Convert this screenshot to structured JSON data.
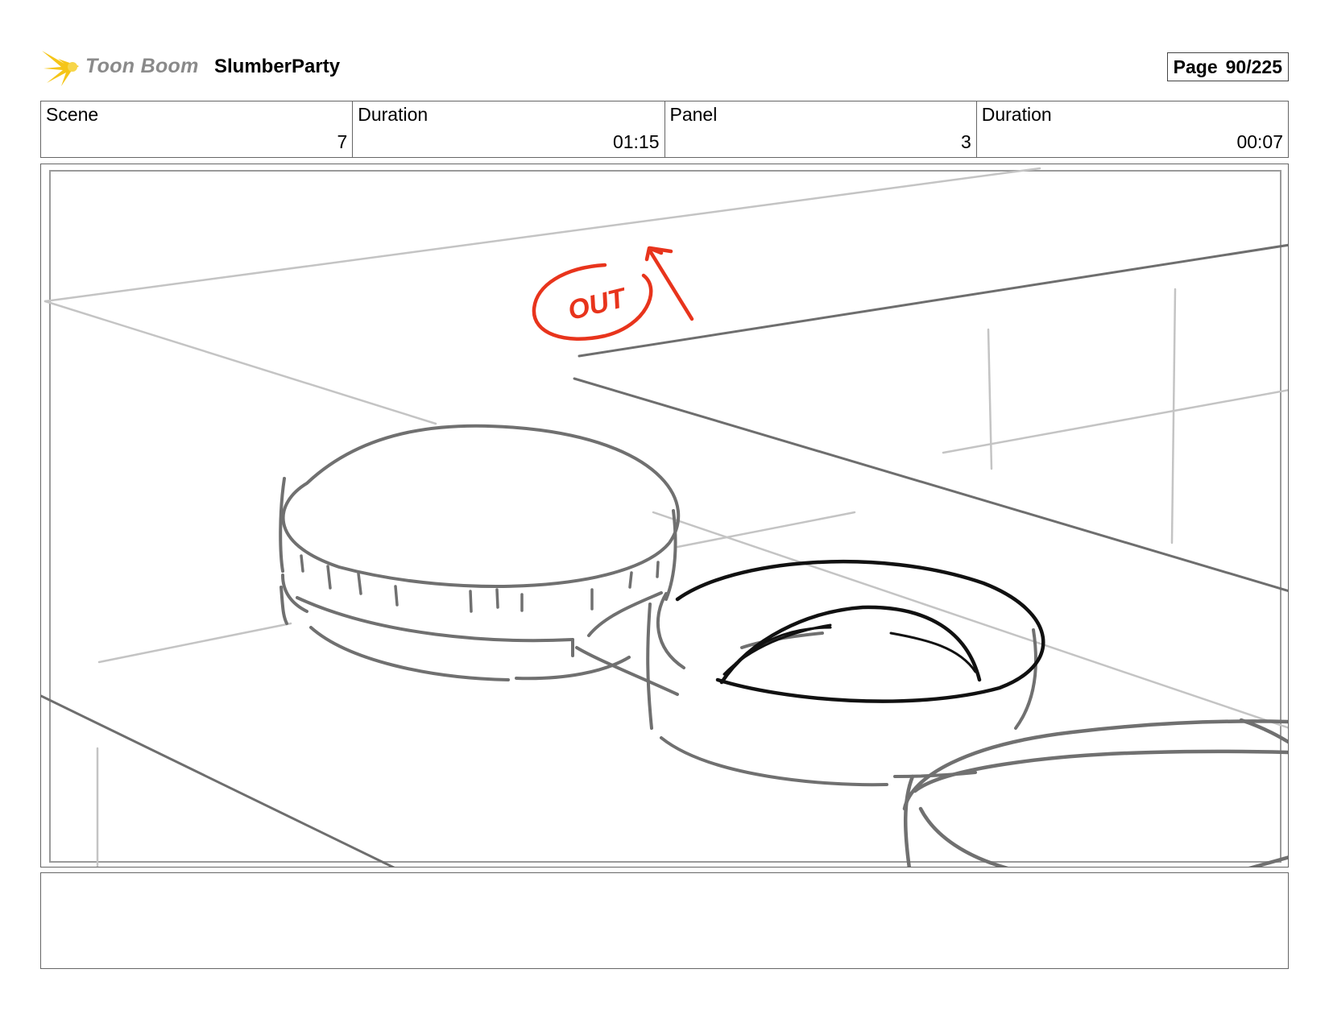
{
  "header": {
    "logo_text": "Toon Boom",
    "project": "SlumberParty",
    "page_label": "Page",
    "page_value": "90/225"
  },
  "info": {
    "scene_label": "Scene",
    "scene_value": "7",
    "scene_duration_label": "Duration",
    "scene_duration_value": "01:15",
    "panel_label": "Panel",
    "panel_value": "3",
    "panel_duration_label": "Duration",
    "panel_duration_value": "00:07"
  },
  "annotation": {
    "text": "OUT",
    "color": "#e8341c"
  },
  "colors": {
    "logo_yellow": "#f5c518",
    "sketch_dark": "#6e6e6e",
    "sketch_light": "#c4c4c4",
    "ink": "#111111"
  },
  "notes": {
    "text": ""
  }
}
